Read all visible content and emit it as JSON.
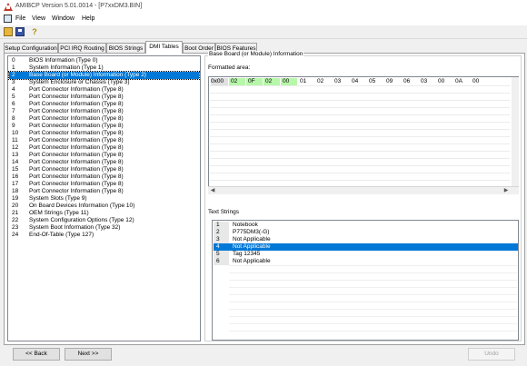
{
  "window": {
    "title": "AMIBCP Version 5.01.0014 - [P7xxDM3.BIN]"
  },
  "menu": {
    "items": [
      "File",
      "View",
      "Window",
      "Help"
    ]
  },
  "tabs": [
    "Setup Configuration",
    "PCI IRQ Routing",
    "BIOS Strings",
    "DMI Tables",
    "Boot Order",
    "BIOS Features"
  ],
  "active_tab": "DMI Tables",
  "dmi_list": [
    {
      "num": "0",
      "label": "BIOS Information  (Type 0)"
    },
    {
      "num": "1",
      "label": "System Information  (Type 1)"
    },
    {
      "num": "2",
      "label": "Base Board (or Module) Information  (Type 2)"
    },
    {
      "num": "3",
      "label": "System Enclosure or Chassis  (Type 3)"
    },
    {
      "num": "4",
      "label": "Port Connector Information  (Type 8)"
    },
    {
      "num": "5",
      "label": "Port Connector Information  (Type 8)"
    },
    {
      "num": "6",
      "label": "Port Connector Information  (Type 8)"
    },
    {
      "num": "7",
      "label": "Port Connector Information  (Type 8)"
    },
    {
      "num": "8",
      "label": "Port Connector Information  (Type 8)"
    },
    {
      "num": "9",
      "label": "Port Connector Information  (Type 8)"
    },
    {
      "num": "10",
      "label": "Port Connector Information  (Type 8)"
    },
    {
      "num": "11",
      "label": "Port Connector Information  (Type 8)"
    },
    {
      "num": "12",
      "label": "Port Connector Information  (Type 8)"
    },
    {
      "num": "13",
      "label": "Port Connector Information  (Type 8)"
    },
    {
      "num": "14",
      "label": "Port Connector Information  (Type 8)"
    },
    {
      "num": "15",
      "label": "Port Connector Information  (Type 8)"
    },
    {
      "num": "16",
      "label": "Port Connector Information  (Type 8)"
    },
    {
      "num": "17",
      "label": "Port Connector Information  (Type 8)"
    },
    {
      "num": "18",
      "label": "Port Connector Information  (Type 8)"
    },
    {
      "num": "19",
      "label": "System Slots  (Type 9)"
    },
    {
      "num": "20",
      "label": "On Board Devices Information  (Type 10)"
    },
    {
      "num": "21",
      "label": "OEM Strings  (Type 11)"
    },
    {
      "num": "22",
      "label": "System Configuration Options  (Type 12)"
    },
    {
      "num": "23",
      "label": "System Boot Information  (Type 32)"
    },
    {
      "num": "24",
      "label": "End-Of-Table  (Type 127)"
    }
  ],
  "selected_index": 2,
  "detail": {
    "group_title": "Base Board (or Module) Information",
    "formatted_label": "Formatted area:",
    "hex_address": "0x00",
    "hex_values": [
      "02",
      "0F",
      "02",
      "00",
      "01",
      "02",
      "03",
      "04",
      "05",
      "09",
      "06",
      "03",
      "00",
      "0A",
      "00"
    ],
    "hex_highlight_count": 4,
    "text_strings_label": "Text Strings",
    "text_strings": [
      {
        "idx": "1",
        "value": "Notebook"
      },
      {
        "idx": "2",
        "value": "P775DM3(-G)"
      },
      {
        "idx": "3",
        "value": "Not Applicable"
      },
      {
        "idx": "4",
        "value": "Not Applicable"
      },
      {
        "idx": "5",
        "value": "Tag 12345"
      },
      {
        "idx": "6",
        "value": "Not Applicable"
      }
    ],
    "selected_string": 3
  },
  "buttons": {
    "back": "<< Back",
    "next": "Next >>",
    "undo": "Undo"
  }
}
